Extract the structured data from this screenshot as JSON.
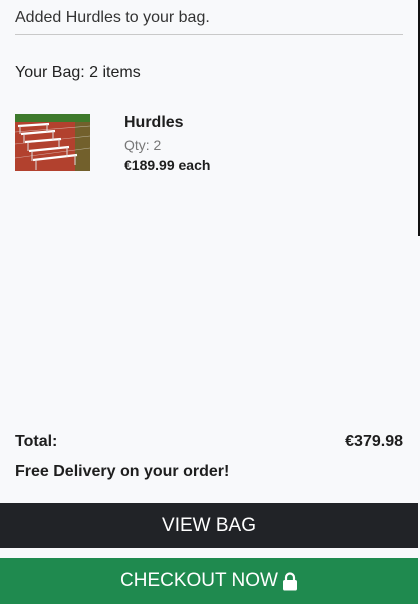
{
  "toast": {
    "message": "Added Hurdles to your bag."
  },
  "bag": {
    "summary": "Your Bag: 2 items",
    "items": [
      {
        "name": "Hurdles",
        "qty": "Qty: 2",
        "price": "€189.99 each",
        "thumbnail_icon": "hurdles-track-image"
      }
    ]
  },
  "totals": {
    "label": "Total:",
    "value": "€379.98",
    "delivery_note": "Free Delivery on your order!"
  },
  "actions": {
    "view_bag": "VIEW BAG",
    "checkout": "CHECKOUT NOW",
    "checkout_icon": "lock-icon"
  },
  "colors": {
    "view_bag_bg": "#212327",
    "checkout_bg": "#1f8a4f",
    "panel_bg": "#f8f9fb"
  }
}
